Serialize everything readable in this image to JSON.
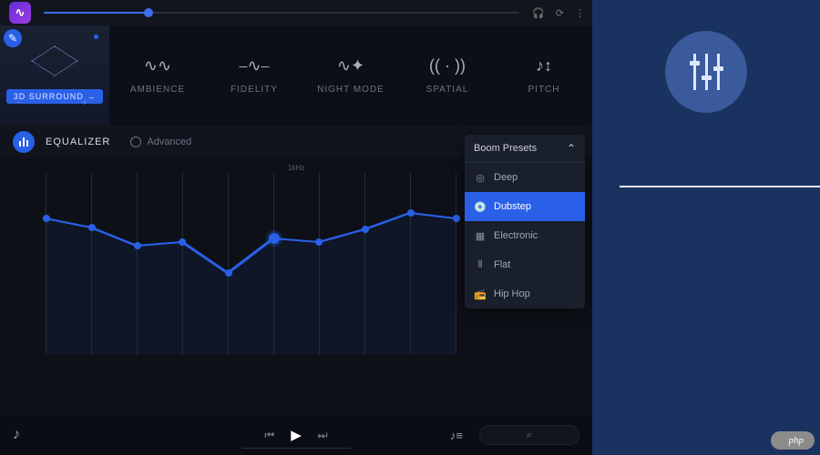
{
  "topbar": {
    "logo_text": "∿",
    "seek_percent": 22
  },
  "effects": [
    {
      "key": "surround",
      "label": "3D SURROUND →",
      "icon": "cube"
    },
    {
      "key": "ambience",
      "label": "AMBIENCE",
      "icon": "waves"
    },
    {
      "key": "fidelity",
      "label": "FIDELITY",
      "icon": "pulse"
    },
    {
      "key": "nightmode",
      "label": "NIGHT MODE",
      "icon": "moon-wave"
    },
    {
      "key": "spatial",
      "label": "SPATIAL",
      "icon": "spatial"
    },
    {
      "key": "pitch",
      "label": "PITCH",
      "icon": "pitch-arrows"
    }
  ],
  "equalizer": {
    "title": "EQUALIZER",
    "advanced_label": "Advanced",
    "center_freq_label": "1kHz",
    "bands_percent": [
      25,
      30,
      40,
      38,
      55,
      36,
      38,
      31,
      22,
      25
    ]
  },
  "presets": {
    "header": "Boom Presets",
    "selected": "Dubstep",
    "items": [
      {
        "label": "Deep",
        "icon": "◎"
      },
      {
        "label": "Dubstep",
        "icon": "💿"
      },
      {
        "label": "Electronic",
        "icon": "▦"
      },
      {
        "label": "Flat",
        "icon": "⦀"
      },
      {
        "label": "Hip Hop",
        "icon": "📻"
      }
    ]
  },
  "player": {
    "now_playing_icon": "♪",
    "prev": "⏮",
    "play": "▶",
    "next": "⏭",
    "queue": "♪≡",
    "search": "⌕"
  },
  "watermark": "php"
}
